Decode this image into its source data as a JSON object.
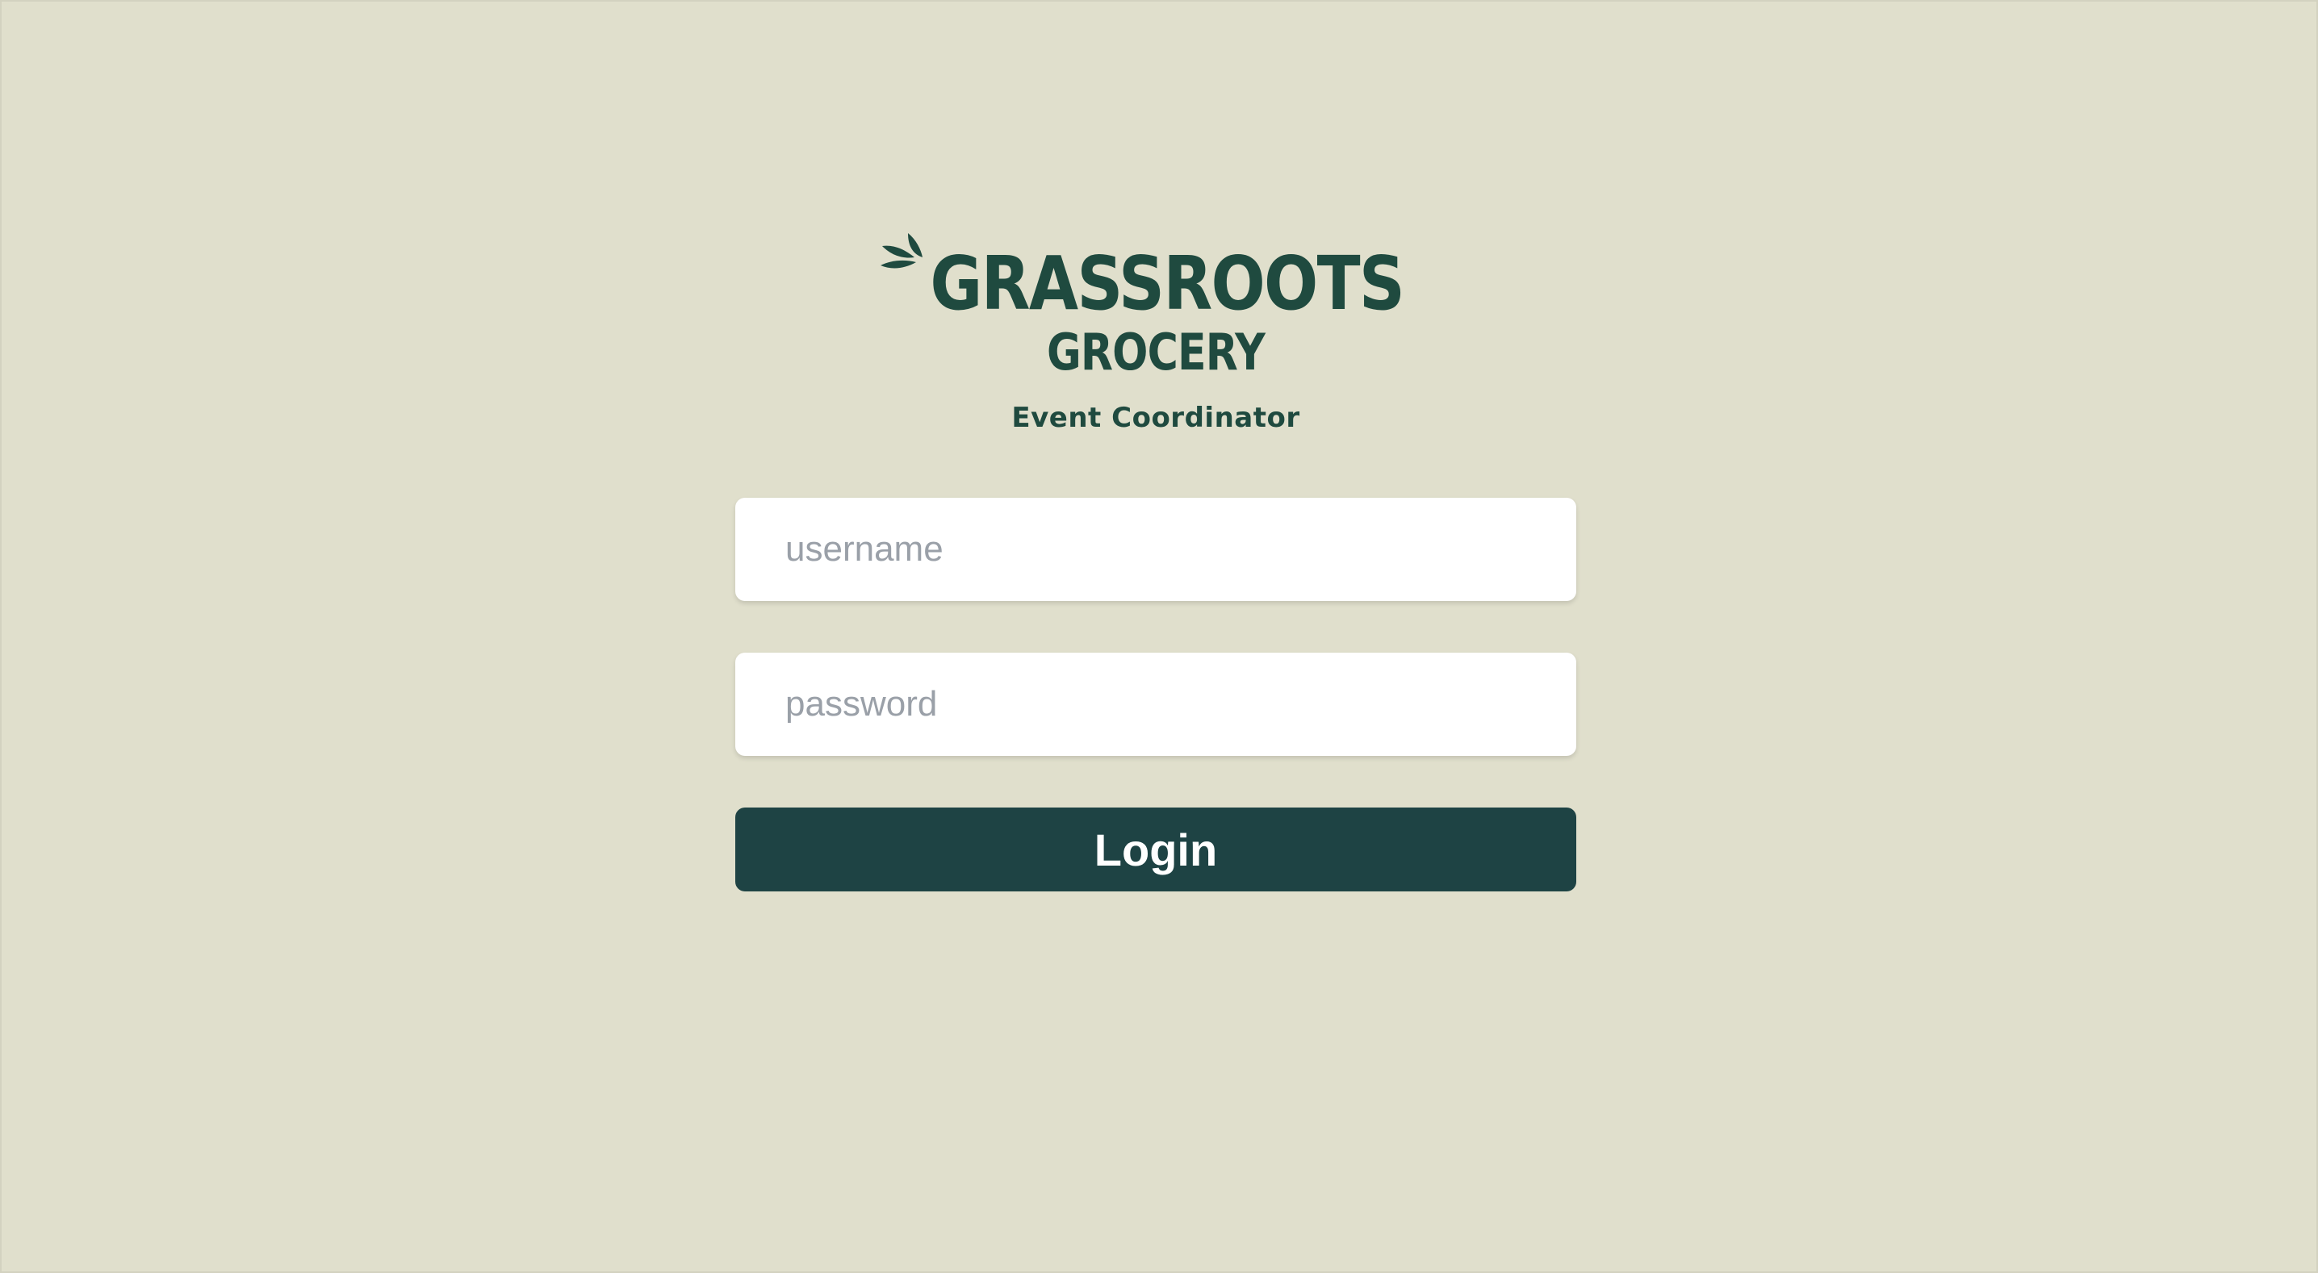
{
  "brand": {
    "name_line1": "GRASSROOTS",
    "name_line2": "GROCERY",
    "subtitle": "Event Coordinator",
    "color": "#1f4a3f",
    "icon": "leaf-icon"
  },
  "form": {
    "username": {
      "value": "",
      "placeholder": "username"
    },
    "password": {
      "value": "",
      "placeholder": "password"
    },
    "login_label": "Login",
    "login_color": "#1e4344"
  },
  "theme": {
    "background": "#e0dfcc"
  }
}
